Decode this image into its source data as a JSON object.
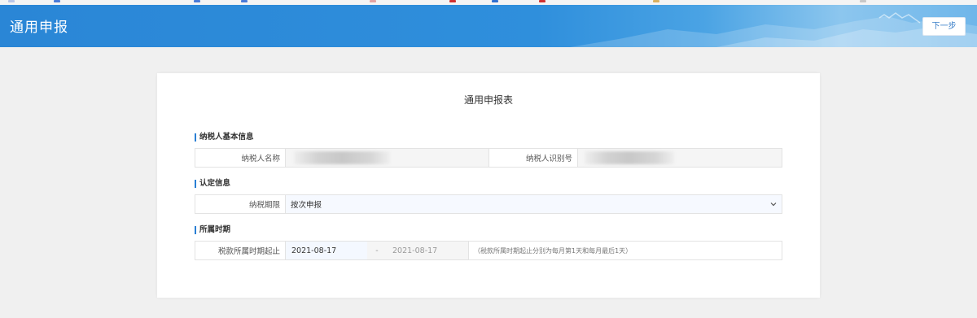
{
  "header": {
    "title": "通用申报",
    "next_button": "下一步"
  },
  "form": {
    "title": "通用申报表",
    "sections": {
      "basic": {
        "label": "纳税人基本信息"
      },
      "auth": {
        "label": "认定信息"
      },
      "period": {
        "label": "所属时期"
      }
    },
    "taxpayer_name_label": "纳税人名称",
    "taxpayer_id_label": "纳税人识别号",
    "tax_term_label": "纳税期限",
    "tax_term_value": "按次申报",
    "period_label": "税款所属时期起止",
    "period_start": "2021-08-17",
    "period_sep": "-",
    "period_end": "2021-08-17",
    "period_hint": "（税款所属时期起止分别为每月第1天和每月最后1天）"
  },
  "colors": {
    "header_blue": "#2a86d6",
    "section_marker": "#2a7fd4",
    "page_bg": "#f0f0f0"
  },
  "icons": {
    "dropdown": "chevron-down-icon"
  }
}
